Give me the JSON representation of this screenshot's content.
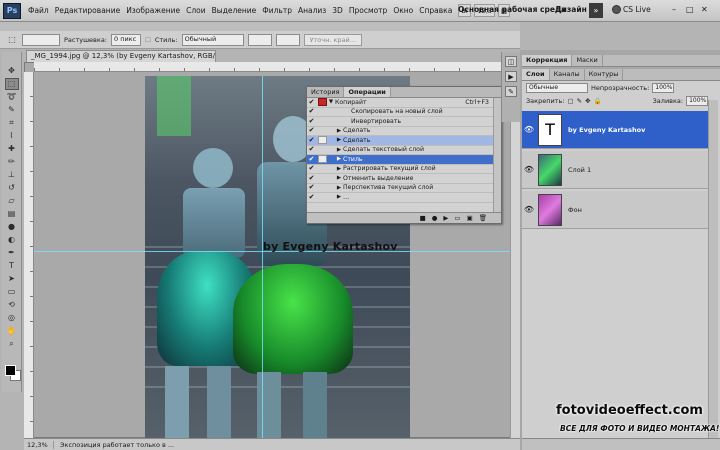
{
  "app": {
    "logo": "Ps",
    "menu": [
      "Файл",
      "Редактирование",
      "Изображение",
      "Слои",
      "Выделение",
      "Фильтр",
      "Анализ",
      "3D",
      "Просмотр",
      "Окно",
      "Справка"
    ],
    "zoom_mini": "12,3",
    "workspace": "Основная рабочая среда",
    "design": "Дизайн",
    "more": "»",
    "cslive": "CS Live",
    "win_min": "–",
    "win_max": "□",
    "win_close": "✕"
  },
  "options": {
    "feather_label": "Растушевка:",
    "feather_value": "0 пикс",
    "style_label": "Стиль:",
    "style_value": "Обычный",
    "refine_edge": "Уточн. край..."
  },
  "document": {
    "tab_title": "_MG_1994.jpg @ 12,3% (by Evgeny Kartashov, RGB/8) *",
    "zoom": "12,3%",
    "status": "Экспозиция работает только в ...",
    "text_layer_overlay": "by Evgeny Kartashov"
  },
  "actions_panel": {
    "tabs": [
      "История",
      "Операции"
    ],
    "active_tab": "Операции",
    "rows": [
      {
        "check": true,
        "dlg": "red",
        "tri": "▼",
        "label": "Копирайт",
        "shortcut": "Ctrl+F3",
        "indent": 0,
        "state": ""
      },
      {
        "check": true,
        "dlg": "blank",
        "tri": "",
        "label": "Скопировать на новый слой",
        "shortcut": "",
        "indent": 2,
        "state": ""
      },
      {
        "check": true,
        "dlg": "blank",
        "tri": "",
        "label": "Инвертировать",
        "shortcut": "",
        "indent": 2,
        "state": ""
      },
      {
        "check": true,
        "dlg": "blank",
        "tri": "▶",
        "label": "Сделать",
        "shortcut": "",
        "indent": 1,
        "state": ""
      },
      {
        "check": true,
        "dlg": "box",
        "tri": "▶",
        "label": "Сделать",
        "shortcut": "",
        "indent": 1,
        "state": "sel2"
      },
      {
        "check": true,
        "dlg": "blank",
        "tri": "▶",
        "label": "Сделать текстовый слой",
        "shortcut": "",
        "indent": 1,
        "state": ""
      },
      {
        "check": true,
        "dlg": "box",
        "tri": "▶",
        "label": "Стиль",
        "shortcut": "",
        "indent": 1,
        "state": "sel"
      },
      {
        "check": true,
        "dlg": "blank",
        "tri": "▶",
        "label": "Растрировать текущий слой",
        "shortcut": "",
        "indent": 1,
        "state": ""
      },
      {
        "check": true,
        "dlg": "blank",
        "tri": "▶",
        "label": "Отменить выделение",
        "shortcut": "",
        "indent": 1,
        "state": ""
      },
      {
        "check": true,
        "dlg": "blank",
        "tri": "▶",
        "label": "Перспектива текущий слой",
        "shortcut": "",
        "indent": 1,
        "state": ""
      },
      {
        "check": true,
        "dlg": "blank",
        "tri": "▶",
        "label": "…",
        "shortcut": "",
        "indent": 1,
        "state": ""
      }
    ],
    "footer_icons": [
      "■",
      "●",
      "▶",
      "▭",
      "▣",
      "🗑"
    ]
  },
  "right_panels": {
    "adj_tabs": [
      "Коррекция",
      "Маски"
    ],
    "layers_tabs": [
      "Слои",
      "Каналы",
      "Контуры"
    ],
    "blend_mode": "Обычные",
    "opacity_label": "Непрозрачность:",
    "opacity_value": "100%",
    "lock_label": "Закрепить:",
    "fill_label": "Заливка:",
    "fill_value": "100%",
    "layers": [
      {
        "name": "by Evgeny Kartashov",
        "type": "text",
        "selected": true,
        "thumb_glyph": "T"
      },
      {
        "name": "Слой 1",
        "type": "image",
        "selected": false,
        "thumb_glyph": ""
      },
      {
        "name": "Фон",
        "type": "image",
        "selected": false,
        "thumb_glyph": ""
      }
    ]
  },
  "branding": {
    "site": "fotovideoeffect.com",
    "tagline": "ВСЕ ДЛЯ ФОТО И ВИДЕО МОНТАЖА!"
  },
  "colors": {
    "selection_blue": "#2f5fc8",
    "action_selected": "#3f6ecb",
    "guide": "#78e6ff",
    "dialog_red": "#c62828"
  }
}
